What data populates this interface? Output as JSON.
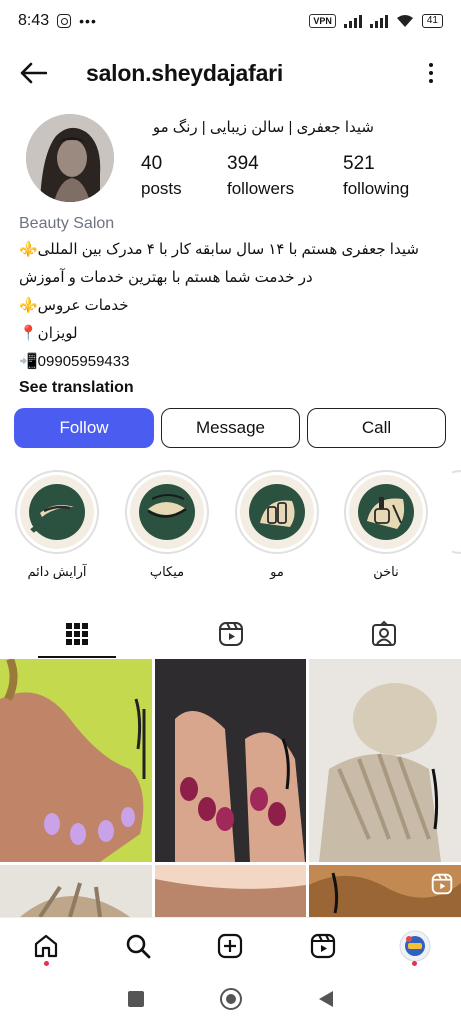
{
  "status_bar": {
    "time": "8:43",
    "vpn": "VPN",
    "battery": "41",
    "icons": [
      "instagram-notification-icon",
      "more-dots-icon",
      "signal-icon",
      "wifi-icon",
      "battery-icon"
    ]
  },
  "header": {
    "username": "salon.sheydajafari",
    "back_icon": "back-arrow-icon",
    "menu_icon": "more-vertical-icon"
  },
  "profile": {
    "full_name": "شیدا جعفری | سالن زیبایی | رنگ مو",
    "stats": [
      {
        "value": "40",
        "label": "posts"
      },
      {
        "value": "394",
        "label": "followers"
      },
      {
        "value": "521",
        "label": "following"
      }
    ],
    "category": "Beauty Salon",
    "bio_lines": [
      "شیدا جعفری هستم با ۱۴ سال سابقه کار با ۴ مدرک بین المللی⚜️",
      "در خدمت شما هستم با بهترین خدمات و آموزش",
      "خدمات عروس⚜️",
      "لویزان📍",
      "📲09905959433"
    ],
    "see_translation": "See translation"
  },
  "actions": {
    "follow": "Follow",
    "message": "Message",
    "call": "Call"
  },
  "highlights": [
    {
      "label": "آرایش دائم",
      "icon": "eyebrow-icon"
    },
    {
      "label": "میکاپ",
      "icon": "eye-makeup-icon"
    },
    {
      "label": "مو",
      "icon": "hair-products-icon"
    },
    {
      "label": "ناخن",
      "icon": "nail-polish-icon"
    }
  ],
  "tabs": [
    {
      "name": "posts-grid",
      "icon": "grid-icon",
      "active": true
    },
    {
      "name": "reels",
      "icon": "reels-icon",
      "active": false
    },
    {
      "name": "tagged",
      "icon": "tagged-person-icon",
      "active": false
    }
  ],
  "grid": [
    {
      "name": "post-lavender-nails"
    },
    {
      "name": "post-burgundy-nails"
    },
    {
      "name": "post-braided-bun"
    },
    {
      "name": "post-braids-2"
    },
    {
      "name": "post-hand-2"
    },
    {
      "name": "post-reel-curls",
      "badge_icon": "reel-badge-icon"
    }
  ],
  "bottom_nav": [
    {
      "name": "home",
      "icon": "home-icon",
      "notification_dot": true
    },
    {
      "name": "search",
      "icon": "search-icon"
    },
    {
      "name": "create",
      "icon": "add-post-icon"
    },
    {
      "name": "reels",
      "icon": "reels-icon"
    },
    {
      "name": "profile",
      "icon": "profile-avatar-icon",
      "notification_dot": true
    }
  ],
  "colors": {
    "accent": "#4a5df0",
    "category": "#6d7380",
    "highlight_bg": "#2b5240",
    "notification": "#e53050"
  }
}
